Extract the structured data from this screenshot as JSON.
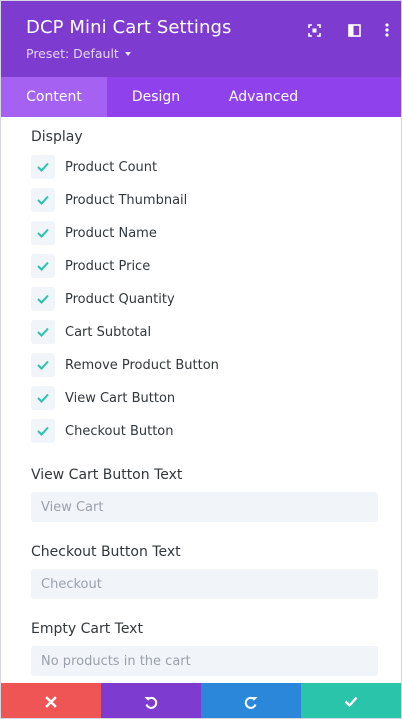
{
  "header": {
    "title": "DCP Mini Cart Settings",
    "preset": "Preset: Default",
    "icons": [
      "focus-icon",
      "sidebar-icon",
      "more-icon"
    ],
    "background": "#7e3bd0"
  },
  "tabs": [
    {
      "label": "Content",
      "active": true
    },
    {
      "label": "Design",
      "active": false
    },
    {
      "label": "Advanced",
      "active": false
    }
  ],
  "display": {
    "label": "Display",
    "options": [
      {
        "label": "Product Count",
        "checked": true
      },
      {
        "label": "Product Thumbnail",
        "checked": true
      },
      {
        "label": "Product Name",
        "checked": true
      },
      {
        "label": "Product Price",
        "checked": true
      },
      {
        "label": "Product Quantity",
        "checked": true
      },
      {
        "label": "Cart Subtotal",
        "checked": true
      },
      {
        "label": "Remove Product Button",
        "checked": true
      },
      {
        "label": "View Cart Button",
        "checked": true
      },
      {
        "label": "Checkout Button",
        "checked": true
      }
    ]
  },
  "fields": [
    {
      "label": "View Cart Button Text",
      "value": "",
      "placeholder": "View Cart"
    },
    {
      "label": "Checkout Button Text",
      "value": "",
      "placeholder": "Checkout"
    },
    {
      "label": "Empty Cart Text",
      "value": "",
      "placeholder": "No products in the cart"
    }
  ],
  "footer": [
    {
      "name": "cancel-button",
      "icon": "close-icon",
      "color": "#ef5555"
    },
    {
      "name": "undo-button",
      "icon": "undo-icon",
      "color": "#7e3bd0"
    },
    {
      "name": "redo-button",
      "icon": "redo-icon",
      "color": "#2b87da"
    },
    {
      "name": "save-button",
      "icon": "check-icon",
      "color": "#29c4a9"
    }
  ],
  "colors": {
    "check": "#29c4a9",
    "tab_bar": "#8f42ec",
    "tab_active": "#a562f2"
  }
}
